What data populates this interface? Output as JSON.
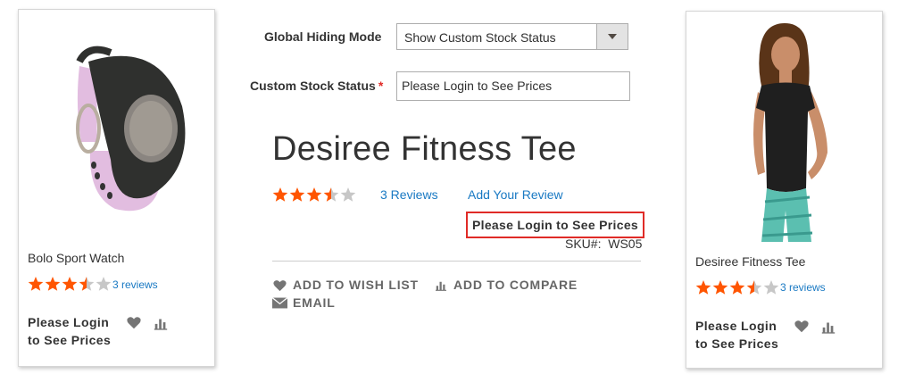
{
  "config": {
    "global_hiding_mode_label": "Global Hiding Mode",
    "global_hiding_mode_value": "Show Custom Stock Status",
    "custom_stock_status_label": "Custom Stock Status",
    "custom_stock_status_required_mark": "*",
    "custom_stock_status_value": "Please Login to See Prices"
  },
  "product": {
    "title": "Desiree Fitness Tee",
    "rating_stars": 3.5,
    "reviews_link": "3 Reviews",
    "add_review_link": "Add Your Review",
    "price_message": "Please Login to See Prices",
    "sku_label": "SKU#:",
    "sku_value": "WS05",
    "actions": {
      "wishlist": "ADD TO WISH LIST",
      "compare": "ADD TO COMPARE",
      "email": "EMAIL"
    }
  },
  "cards": [
    {
      "name": "Bolo Sport Watch",
      "rating_stars": 3.5,
      "reviews": "3 reviews",
      "price_line1": "Please Login",
      "price_line2": "to See Prices"
    },
    {
      "name": "Desiree Fitness Tee",
      "rating_stars": 3.5,
      "reviews": "3 reviews",
      "price_line1": "Please Login",
      "price_line2": "to See Prices"
    }
  ],
  "colors": {
    "star_filled": "#ff5501",
    "star_empty": "#c7c7c7",
    "link": "#1979c3",
    "highlight_border": "#e02b27"
  }
}
